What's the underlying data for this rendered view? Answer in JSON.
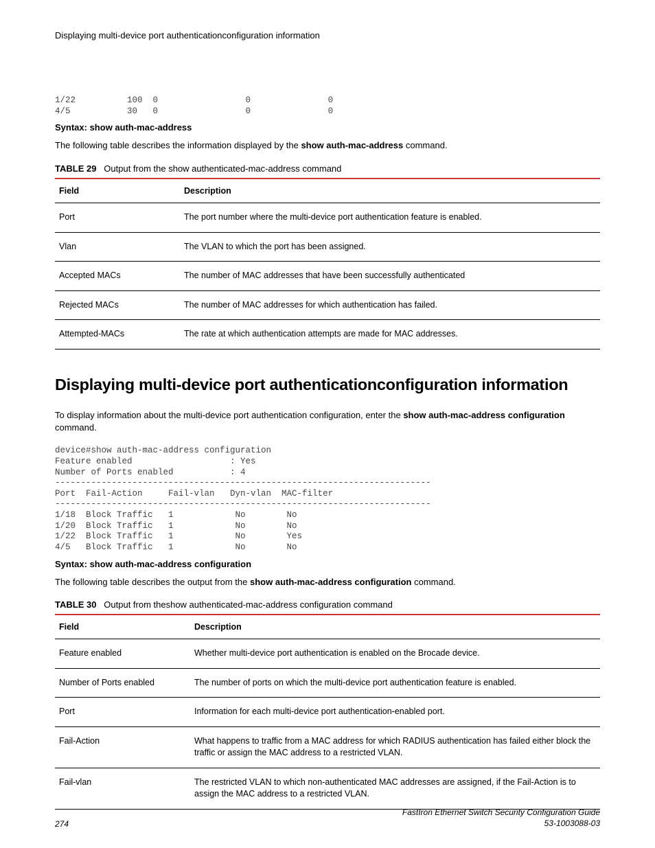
{
  "header": {
    "running_title": "Displaying multi-device port authenticationconfiguration information"
  },
  "pre_block_1": "1/22          100  0                 0               0\n4/5           30   0                 0               0",
  "syntax_1": {
    "prefix": "Syntax: ",
    "cmd": "show auth-mac-address"
  },
  "para_1": {
    "text_before": "The following table describes the information displayed by the ",
    "bold": "show auth-mac-address",
    "text_after": " command."
  },
  "table29": {
    "caption_num": "TABLE 29",
    "caption_title": "Output from the show authenticated-mac-address command",
    "head_field": "Field",
    "head_desc": "Description",
    "rows": [
      {
        "field": "Port",
        "desc": "The port number where the multi-device port authentication feature is enabled."
      },
      {
        "field": "Vlan",
        "desc": "The VLAN to which the port has been assigned."
      },
      {
        "field": "Accepted MACs",
        "desc": "The number of MAC addresses that have been successfully authenticated"
      },
      {
        "field": "Rejected MACs",
        "desc": "The number of MAC addresses for which authentication has failed."
      },
      {
        "field": "Attempted-MACs",
        "desc": "The rate at which authentication attempts are made for MAC addresses."
      }
    ]
  },
  "section_title": "Displaying multi-device port authenticationconfiguration information",
  "para_2": {
    "text_before": "To display information about the multi-device port authentication configuration, enter the ",
    "bold": "show auth-mac-address configuration",
    "text_after": " command."
  },
  "pre_block_2": "device#show auth-mac-address configuration\nFeature enabled                   : Yes\nNumber of Ports enabled           : 4\n-------------------------------------------------------------------------\nPort  Fail-Action     Fail-vlan   Dyn-vlan  MAC-filter\n-------------------------------------------------------------------------\n1/18  Block Traffic   1            No        No\n1/20  Block Traffic   1            No        No\n1/22  Block Traffic   1            No        Yes\n4/5   Block Traffic   1            No        No",
  "syntax_2": {
    "prefix": "Syntax: ",
    "cmd": "show auth-mac-address configuration"
  },
  "para_3": {
    "text_before": "The following table describes the output from the ",
    "bold": "show auth-mac-address configuration",
    "text_after": " command."
  },
  "table30": {
    "caption_num": "TABLE 30",
    "caption_title": "Output from theshow authenticated-mac-address configuration command",
    "head_field": "Field",
    "head_desc": "Description",
    "rows": [
      {
        "field": "Feature enabled",
        "desc": "Whether multi-device port authentication is enabled on the Brocade device."
      },
      {
        "field": "Number of Ports enabled",
        "desc": "The number of ports on which the multi-device port authentication feature is enabled."
      },
      {
        "field": "Port",
        "desc": "Information for each multi-device port authentication-enabled port."
      },
      {
        "field": "Fail-Action",
        "desc": "What happens to traffic from a MAC address for which RADIUS authentication has failed either block the traffic or assign the MAC address to a restricted VLAN."
      },
      {
        "field": "Fail-vlan",
        "desc": "The restricted VLAN to which non-authenticated MAC addresses are assigned, if the Fail-Action is to assign the MAC address to a restricted VLAN."
      }
    ]
  },
  "footer": {
    "page_number": "274",
    "doc_title": "FastIron Ethernet Switch Security Configuration Guide",
    "doc_id": "53-1003088-03"
  }
}
